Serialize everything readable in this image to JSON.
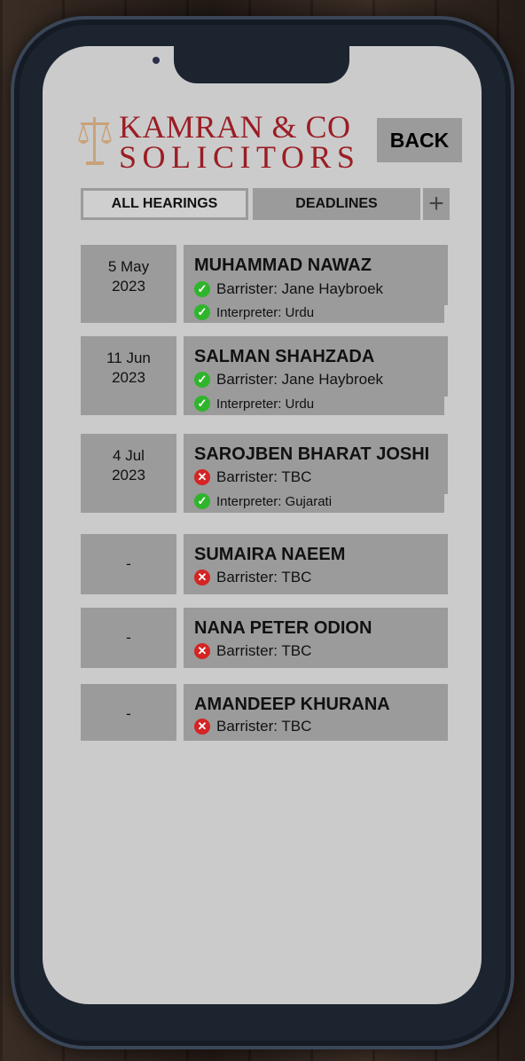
{
  "header": {
    "logo_line1": "KAMRAN & CO",
    "logo_line2": "SOLICITORS",
    "back_label": "BACK"
  },
  "tabs": {
    "all_hearings": "ALL HEARINGS",
    "deadlines": "DEADLINES",
    "add": "+"
  },
  "hearings": [
    {
      "date_line1": "5 May",
      "date_line2": "2023",
      "name": "MUHAMMAD NAWAZ",
      "barrister": "Barrister: Jane Haybroek",
      "barrister_status": "ok",
      "interpreter": "Interpreter: Urdu",
      "interpreter_status": "ok"
    },
    {
      "date_line1": "11 Jun",
      "date_line2": "2023",
      "name": "SALMAN SHAHZADA",
      "barrister": "Barrister: Jane Haybroek",
      "barrister_status": "ok",
      "interpreter": "Interpreter: Urdu",
      "interpreter_status": "ok"
    },
    {
      "date_line1": "4 Jul",
      "date_line2": "2023",
      "name": "SAROJBEN BHARAT JOSHI",
      "barrister": "Barrister: TBC",
      "barrister_status": "no",
      "interpreter": "Interpreter: Gujarati",
      "interpreter_status": "ok"
    },
    {
      "date_line1": "-",
      "name": "SUMAIRA NAEEM",
      "barrister": "Barrister: TBC",
      "barrister_status": "no"
    },
    {
      "date_line1": "-",
      "name": "NANA PETER ODION",
      "barrister": "Barrister: TBC",
      "barrister_status": "no"
    },
    {
      "date_line1": "-",
      "name": "AMANDEEP KHURANA",
      "barrister": "Barrister: TBC",
      "barrister_status": "no"
    }
  ],
  "colors": {
    "brand_red": "#9b1d24",
    "panel_grey": "#9b9b9b",
    "screen_bg": "#cbcbcb",
    "ok_green": "#2fb52c",
    "no_red": "#d42424"
  },
  "icons": {
    "ok": "check-circle-icon",
    "no": "cross-circle-icon"
  }
}
